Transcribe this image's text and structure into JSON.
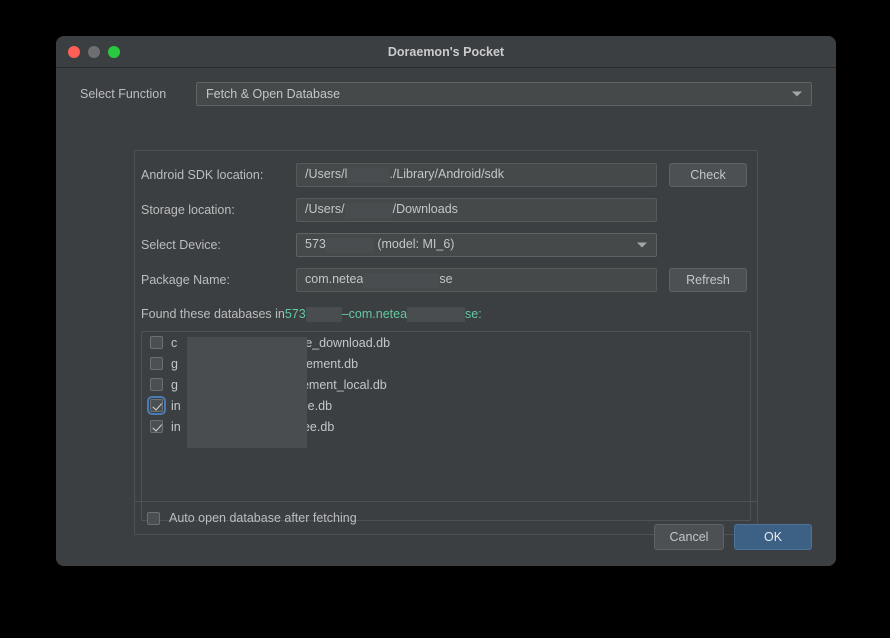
{
  "window": {
    "title": "Doraemon's Pocket",
    "traffic_lights": [
      "close-button",
      "minimize-button",
      "maximize-button"
    ]
  },
  "function_row": {
    "label": "Select Function",
    "selected": "Fetch & Open Database",
    "arrow_icon": "chevron-down-icon"
  },
  "form": {
    "sdk": {
      "label": "Android SDK location:",
      "value_prefix": "/Users/l",
      "value_suffix": "./Library/Android/sdk",
      "button": "Check"
    },
    "storage": {
      "label": "Storage location:",
      "value_prefix": "/Users/",
      "value_suffix": "/Downloads"
    },
    "device": {
      "label": "Select Device:",
      "value_prefix": "573",
      "value_suffix": "(model: MI_6)",
      "arrow_icon": "chevron-down-icon"
    },
    "package": {
      "label": "Package Name:",
      "value_prefix": "com.netea",
      "value_suffix": "se",
      "button": "Refresh"
    }
  },
  "found": {
    "prefix": "Found these databases in ",
    "device_id": "573",
    "separator": " – ",
    "package": "com.netea",
    "package_suffix": "se",
    "colon": ":",
    "accent_color": "#62c8a0"
  },
  "databases": [
    {
      "name_prefix": "c",
      "name_suffix": "e_download.db",
      "checked": false,
      "focused": false
    },
    {
      "name_prefix": "g",
      "name_suffix": "ement.db",
      "checked": false,
      "focused": false
    },
    {
      "name_prefix": "g",
      "name_suffix": "ement_local.db",
      "checked": false,
      "focused": false
    },
    {
      "name_prefix": "in",
      "name_suffix": "ee.db",
      "checked": true,
      "focused": true
    },
    {
      "name_prefix": "in",
      "name_suffix": "cee.db",
      "checked": true,
      "focused": false
    }
  ],
  "auto_open": {
    "label": "Auto open database after fetching",
    "checked": false
  },
  "footer": {
    "cancel": "Cancel",
    "ok": "OK",
    "ok_color": "#3d6185"
  }
}
